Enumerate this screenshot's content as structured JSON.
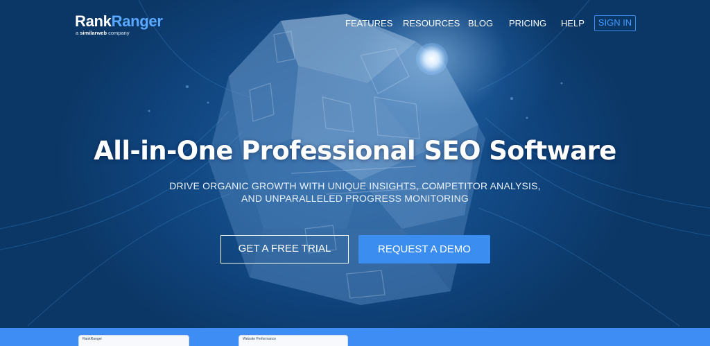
{
  "brand": {
    "name_part1": "Rank",
    "name_part2": "Ranger",
    "tagline_prefix": "a ",
    "tagline_brand": "similarweb",
    "tagline_suffix": " company"
  },
  "nav": {
    "items": [
      "FEATURES",
      "RESOURCES",
      "BLOG",
      "PRICING",
      "HELP"
    ],
    "signin": "SIGN IN"
  },
  "hero": {
    "headline": "All-in-One Professional SEO Software",
    "sub_line1": "DRIVE ORGANIC GROWTH WITH UNIQUE INSIGHTS, COMPETITOR ANALYSIS,",
    "sub_line2": "AND UNPARALLELED PROGRESS MONITORING",
    "trial_button": "GET A FREE TRIAL",
    "demo_button": "REQUEST A DEMO"
  },
  "preview": {
    "card1_label": "RankRanger",
    "card2_label": "Website Performance"
  },
  "colors": {
    "accent": "#3b8df0",
    "hero_bg": "#154f8c",
    "band": "#3d8df5"
  }
}
